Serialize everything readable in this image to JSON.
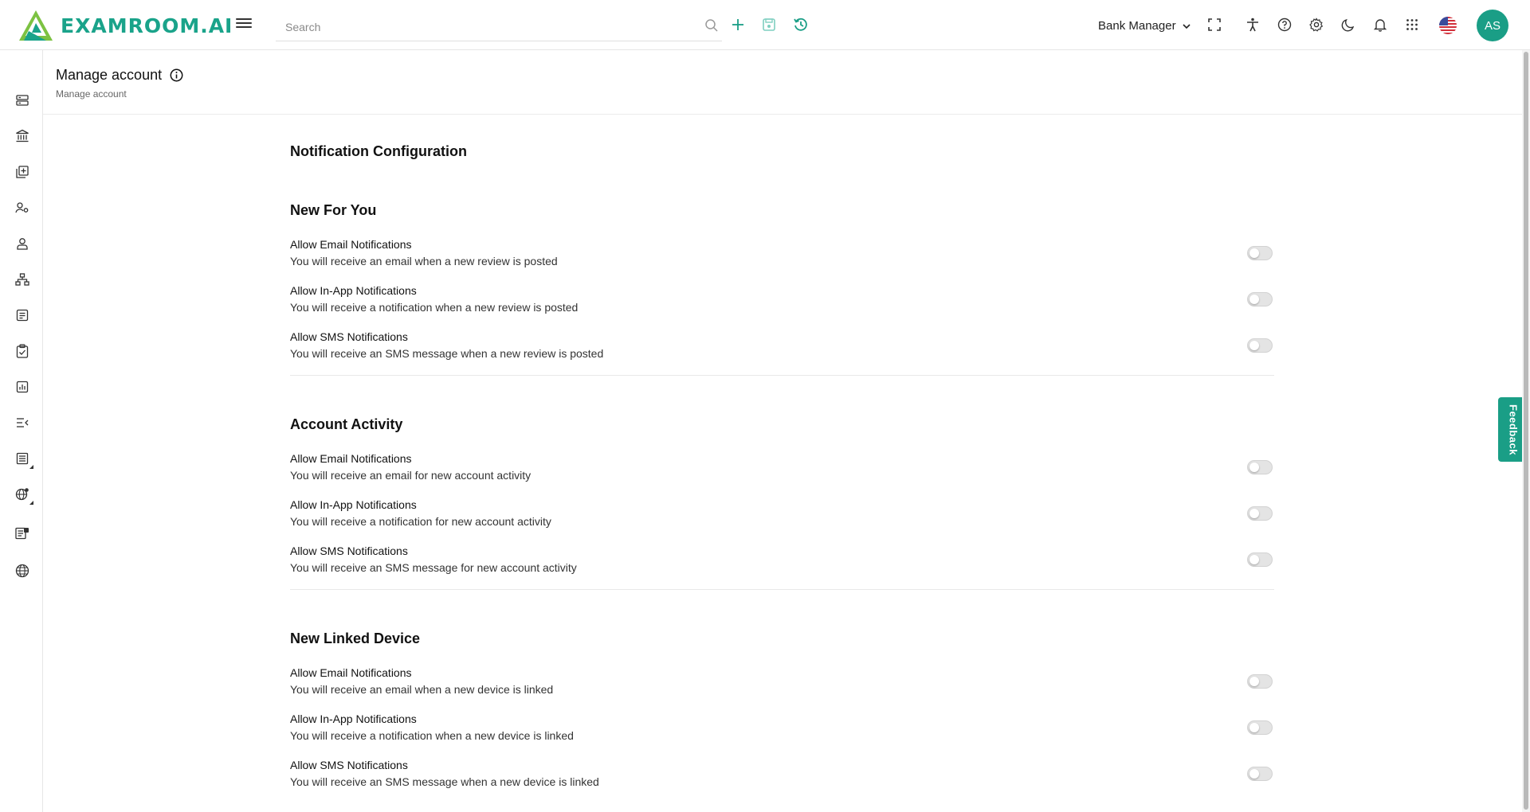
{
  "app": {
    "logo_text": "EXAMROOM.AI",
    "brand_color": "#1a9e86"
  },
  "topbar": {
    "search_placeholder": "Search",
    "role": "Bank Manager",
    "avatar_initials": "AS",
    "icons": [
      "menu-icon",
      "search-icon",
      "plus-icon",
      "save-icon",
      "history-icon",
      "fullscreen-icon",
      "accessibility-icon",
      "help-icon",
      "settings-icon",
      "dark-mode-icon",
      "bell-icon",
      "apps-grid-icon",
      "us-flag-icon"
    ]
  },
  "sidebar": {
    "icons": [
      "server-icon",
      "bank-icon",
      "add-library-icon",
      "user-settings-icon",
      "user-icon",
      "sitemap-icon",
      "document-list-icon",
      "clipboard-check-icon",
      "chart-icon",
      "list-collapse-icon",
      "table-list-icon",
      "globe-settings-icon",
      "report-icon",
      "globe-icon"
    ]
  },
  "page": {
    "title": "Manage account",
    "breadcrumb": "Manage account"
  },
  "content": {
    "heading": "Notification Configuration",
    "groups": [
      {
        "title": "New For You",
        "items": [
          {
            "label": "Allow Email Notifications",
            "desc": "You will receive an email when a new review is posted",
            "enabled": false
          },
          {
            "label": "Allow In-App Notifications",
            "desc": "You will receive a notification when a new review is posted",
            "enabled": false
          },
          {
            "label": "Allow SMS Notifications",
            "desc": "You will receive an SMS message when a new review is posted",
            "enabled": false
          }
        ]
      },
      {
        "title": "Account Activity",
        "items": [
          {
            "label": "Allow Email Notifications",
            "desc": "You will receive an email for new account activity",
            "enabled": false
          },
          {
            "label": "Allow In-App Notifications",
            "desc": "You will receive a notification for new account activity",
            "enabled": false
          },
          {
            "label": "Allow SMS Notifications",
            "desc": "You will receive an SMS message for new account activity",
            "enabled": false
          }
        ]
      },
      {
        "title": "New Linked Device",
        "items": [
          {
            "label": "Allow Email Notifications",
            "desc": "You will receive an email when a new device is linked",
            "enabled": false
          },
          {
            "label": "Allow In-App Notifications",
            "desc": "You will receive a notification when a new device is linked",
            "enabled": false
          },
          {
            "label": "Allow SMS Notifications",
            "desc": "You will receive an SMS message when a new device is linked",
            "enabled": false
          }
        ]
      }
    ]
  },
  "feedback": {
    "label": "Feedback"
  }
}
